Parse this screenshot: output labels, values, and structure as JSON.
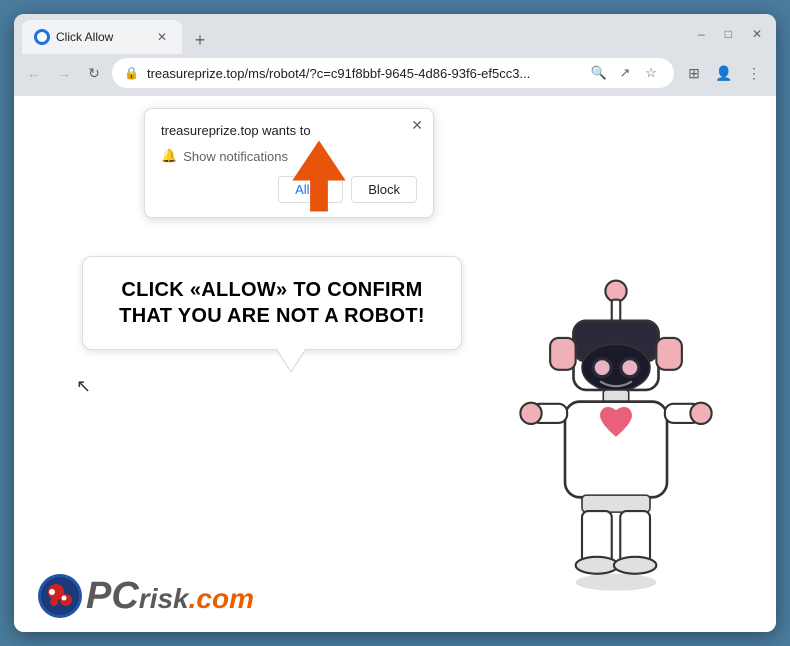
{
  "browser": {
    "tab": {
      "title": "Click Allow",
      "favicon": "browser-favicon"
    },
    "new_tab_label": "+",
    "window_controls": {
      "minimize": "–",
      "maximize": "□",
      "close": "✕"
    },
    "nav": {
      "back": "←",
      "forward": "→",
      "refresh": "↻"
    },
    "url": "treasureprize.top/ms/robot4/?c=c91f8bbf-9645-4d86-93f6-ef5cc3...",
    "url_actions": {
      "search": "🔍",
      "share": "↗",
      "bookmark": "☆"
    },
    "toolbar": {
      "extensions": "⊞",
      "profile": "👤",
      "menu": "⋮"
    }
  },
  "notification_popup": {
    "site": "treasureprize.top wants to",
    "close_btn": "✕",
    "notification_label": "Show notifications",
    "allow_btn": "Allow",
    "block_btn": "Block"
  },
  "speech_bubble": {
    "text": "CLICK «ALLOW» TO CONFIRM THAT YOU ARE NOT A ROBOT!"
  },
  "pcrisk": {
    "logo_text": "PC",
    "logo_suffix": "risk",
    "domain": ".com"
  },
  "colors": {
    "arrow": "#e8540a",
    "allow_btn_color": "#1a73e8",
    "accent": "#e85a00"
  }
}
